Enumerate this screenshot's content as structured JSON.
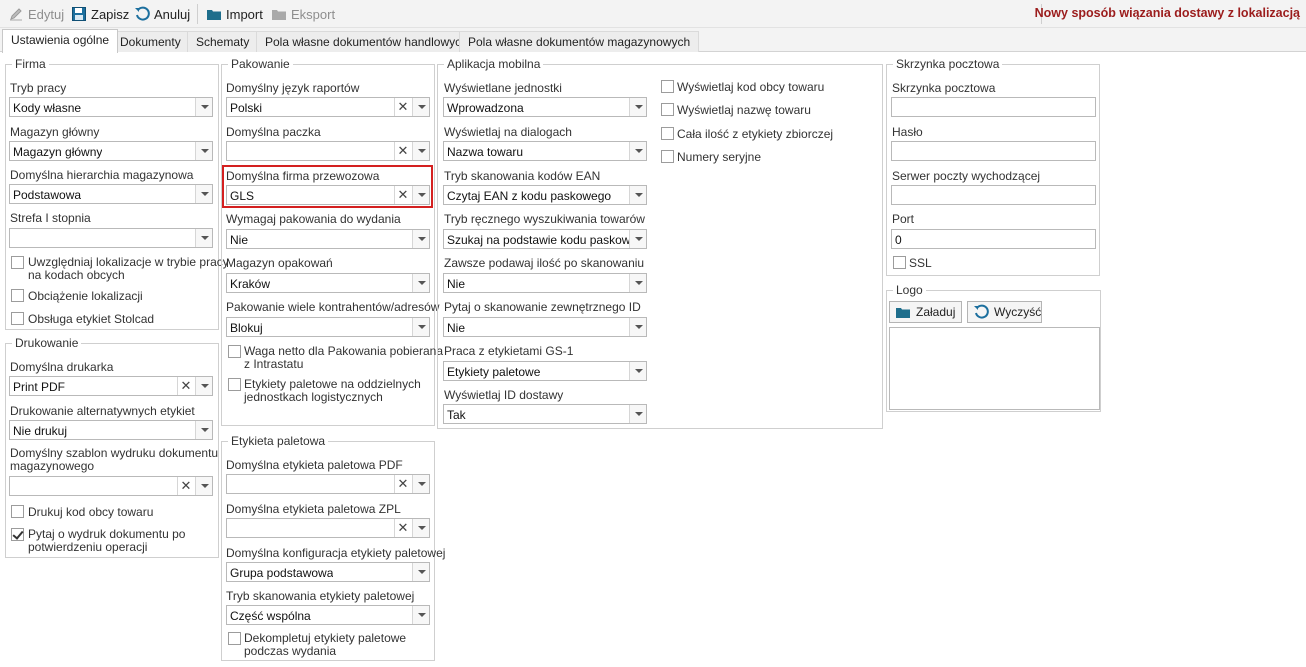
{
  "toolbar": {
    "edit_label": "Edytuj",
    "save_label": "Zapisz",
    "cancel_label": "Anuluj",
    "import_label": "Import",
    "export_label": "Eksport",
    "notice": "Nowy sposób wiązania dostawy z lokalizacją"
  },
  "tabs": [
    {
      "label": "Ustawienia ogólne"
    },
    {
      "label": "Dokumenty"
    },
    {
      "label": "Schematy"
    },
    {
      "label": "Pola własne dokumentów handlowych"
    },
    {
      "label": "Pola własne dokumentów magazynowych"
    }
  ],
  "firma": {
    "title": "Firma",
    "tryb_pracy": {
      "label": "Tryb pracy",
      "value": "Kody własne"
    },
    "magazyn": {
      "label": "Magazyn główny",
      "value": "Magazyn główny"
    },
    "hierarchia": {
      "label": "Domyślna hierarchia magazynowa",
      "value": "Podstawowa"
    },
    "strefa": {
      "label": "Strefa I stopnia",
      "value": ""
    },
    "chk1": {
      "line1": "Uwzględniaj lokalizacje w trybie pracy",
      "line2": "na kodach obcych",
      "checked": false
    },
    "chk2": {
      "label": "Obciążenie lokalizacji",
      "checked": false
    },
    "chk3": {
      "label": "Obsługa etykiet Stolcad",
      "checked": false
    }
  },
  "drukowanie": {
    "title": "Drukowanie",
    "drukarka": {
      "label": "Domyślna drukarka",
      "value": "Print PDF"
    },
    "alt": {
      "label": "Drukowanie alternatywnych etykiet",
      "value": "Nie drukuj"
    },
    "szablon": {
      "line1": "Domyślny szablon wydruku dokumentu",
      "line2": "magazynowego",
      "value": ""
    },
    "chk1": {
      "label": "Drukuj kod obcy towaru",
      "checked": false
    },
    "chk2": {
      "line1": "Pytaj o wydruk dokumentu po",
      "line2": "potwierdzeniu operacji",
      "checked": true
    }
  },
  "pakowanie": {
    "title": "Pakowanie",
    "jezyk": {
      "label": "Domyślny język raportów",
      "value": "Polski"
    },
    "paczka": {
      "label": "Domyślna paczka",
      "value": ""
    },
    "firma_przewozowa": {
      "label": "Domyślna firma przewozowa",
      "value": "GLS"
    },
    "wymagaj": {
      "label": "Wymagaj pakowania do wydania",
      "value": "Nie"
    },
    "magazyn_opakowan": {
      "label": "Magazyn opakowań",
      "value": "Kraków"
    },
    "wiele": {
      "label": "Pakowanie wiele kontrahentów/adresów",
      "value": "Blokuj"
    },
    "chk1": {
      "line1": "Waga netto dla Pakowania pobierana",
      "line2": "z Intrastatu",
      "checked": false
    },
    "chk2": {
      "line1": "Etykiety paletowe na oddzielnych",
      "line2": "jednostkach logistycznych",
      "checked": false
    }
  },
  "etykieta": {
    "title": "Etykieta paletowa",
    "pdf": {
      "label": "Domyślna etykieta paletowa PDF",
      "value": ""
    },
    "zpl": {
      "label": "Domyślna etykieta paletowa ZPL",
      "value": ""
    },
    "konfig": {
      "label": "Domyślna konfiguracja etykiety paletowej",
      "value": "Grupa podstawowa"
    },
    "skan": {
      "label": "Tryb skanowania etykiety paletowej",
      "value": "Część wspólna"
    },
    "chk1": {
      "line1": "Dekompletuj etykiety paletowe",
      "line2": "podczas wydania",
      "checked": false
    }
  },
  "mobilna": {
    "title": "Aplikacja mobilna",
    "jednostki": {
      "label": "Wyświetlane jednostki",
      "value": "Wprowadzona"
    },
    "dialogi": {
      "label": "Wyświetlaj na dialogach",
      "value": "Nazwa towaru"
    },
    "ean": {
      "label": "Tryb skanowania kodów EAN",
      "value": "Czytaj EAN z kodu paskowego"
    },
    "reczny": {
      "label": "Tryb ręcznego wyszukiwania towarów",
      "value": "Szukaj na podstawie kodu paskowe..."
    },
    "ilosc": {
      "label": "Zawsze podawaj ilość po skanowaniu",
      "value": "Nie"
    },
    "zewn": {
      "label": "Pytaj o skanowanie zewnętrznego ID",
      "value": "Nie"
    },
    "gs1": {
      "label": "Praca z etykietami GS-1",
      "value": "Etykiety paletowe"
    },
    "id_dostawy": {
      "label": "Wyświetlaj ID dostawy",
      "value": "Tak"
    },
    "chk1": {
      "label": "Wyświetlaj kod obcy towaru",
      "checked": false
    },
    "chk2": {
      "label": "Wyświetlaj nazwę towaru",
      "checked": false
    },
    "chk3": {
      "label": "Cała ilość z etykiety zbiorczej",
      "checked": false
    },
    "chk4": {
      "label": "Numery seryjne",
      "checked": false
    }
  },
  "skrzynka": {
    "title": "Skrzynka pocztowa",
    "skrzynka": {
      "label": "Skrzynka pocztowa",
      "value": ""
    },
    "haslo": {
      "label": "Hasło",
      "value": ""
    },
    "serwer": {
      "label": "Serwer poczty wychodzącej",
      "value": ""
    },
    "port": {
      "label": "Port",
      "value": "0"
    },
    "ssl": {
      "label": "SSL",
      "checked": false
    }
  },
  "logo": {
    "title": "Logo",
    "load_label": "Załaduj",
    "clear_label": "Wyczyść"
  },
  "colors": {
    "notice": "#9b1c1c",
    "highlight": "#d42020",
    "folder": "#1e6e8c"
  }
}
